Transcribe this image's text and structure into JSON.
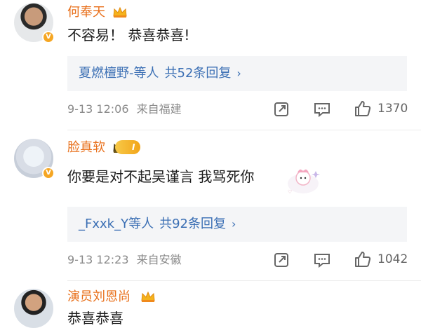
{
  "comments": [
    {
      "username": "何奉天",
      "text": "不容易！ 恭喜恭喜!",
      "reply_users": "夏燃檀野-等人",
      "reply_count": "共52条回复",
      "date": "9-13 12:06",
      "source": "来自福建",
      "likes": "1370"
    },
    {
      "username": "脸真软",
      "level": "I",
      "text": "你要是对不起吴谨言 我骂死你",
      "reply_users": "_Fxxk_Y等人",
      "reply_count": "共92条回复",
      "date": "9-13 12:23",
      "source": "来自安徽",
      "likes": "1042"
    },
    {
      "username": "演员刘恩尚",
      "text": "恭喜恭喜"
    }
  ],
  "icons": {
    "share": "share-icon",
    "comment": "comment-icon",
    "like": "thumbs-up-icon",
    "crown": "crown-icon",
    "verified": "verified-badge-icon"
  },
  "colors": {
    "username": "#e86f1a",
    "link": "#3b6fb4",
    "meta": "#8a8a8a",
    "reply_bg": "#f4f5f7"
  }
}
